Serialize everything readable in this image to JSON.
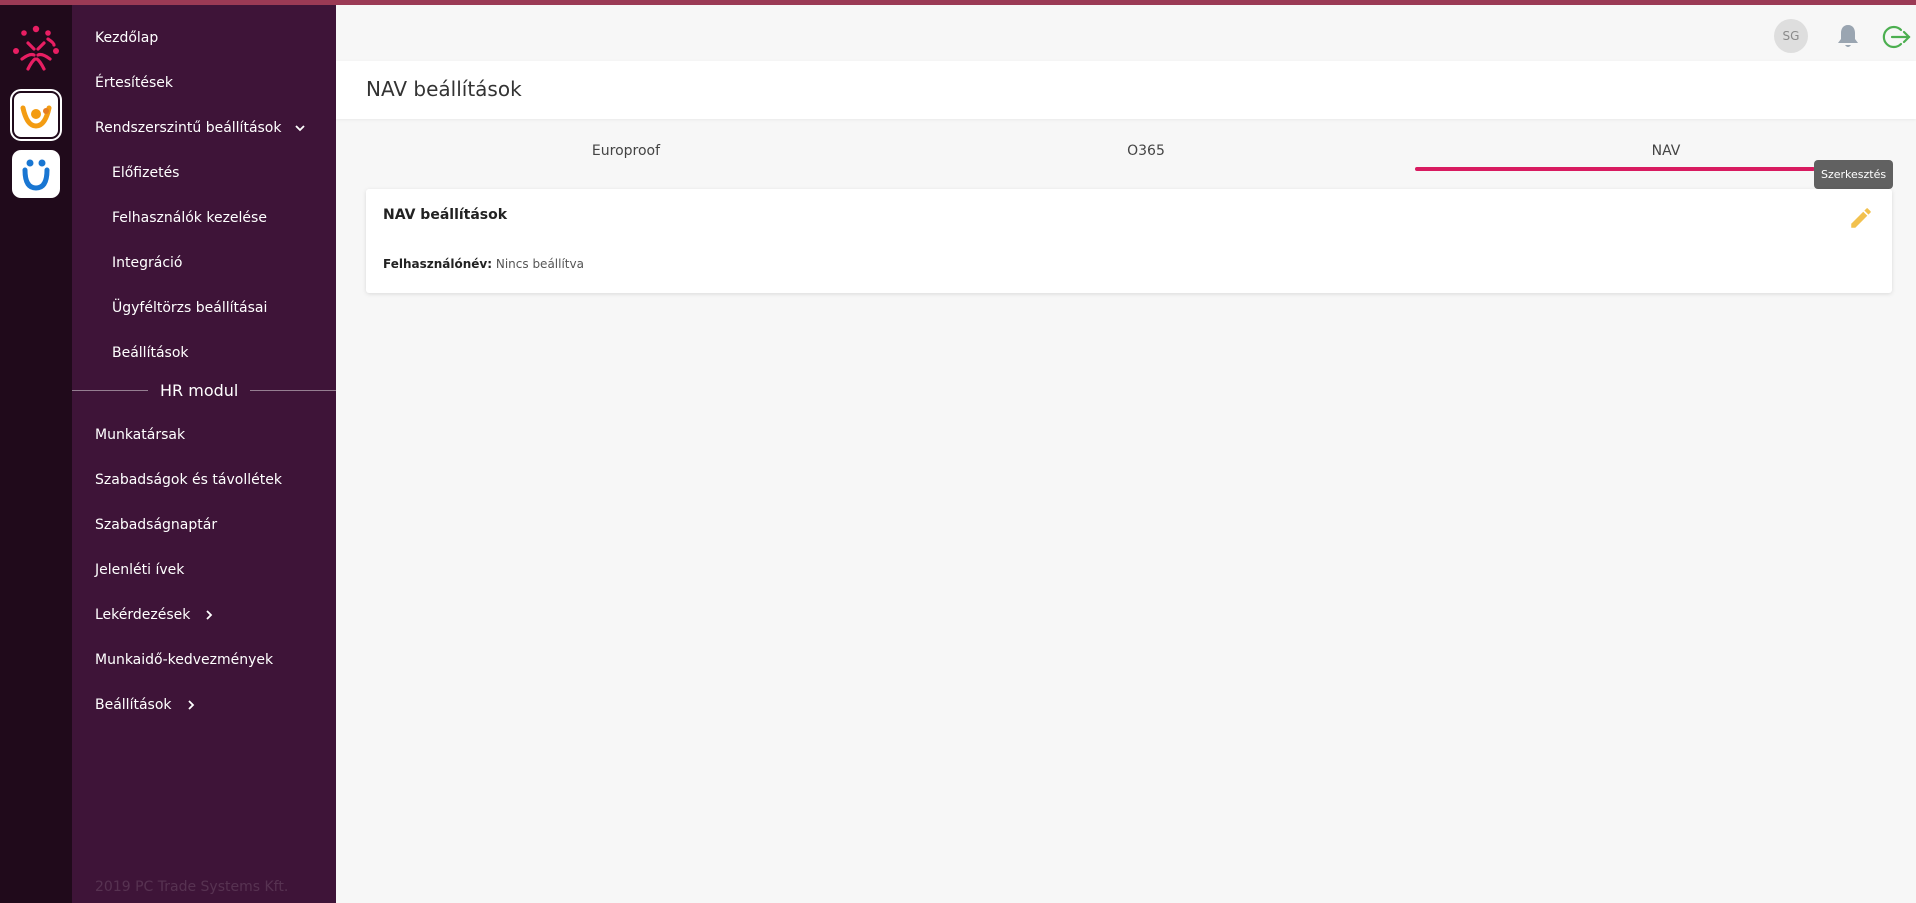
{
  "sidebar": {
    "items": [
      {
        "label": "Kezdőlap"
      },
      {
        "label": "Értesítések"
      },
      {
        "label": "Rendszerszintű beállítások"
      },
      {
        "label": "Előfizetés"
      },
      {
        "label": "Felhasználók kezelése"
      },
      {
        "label": "Integráció"
      },
      {
        "label": "Ügyféltörzs beállításai"
      },
      {
        "label": "Beállítások"
      }
    ],
    "section_title": "HR modul",
    "hr_items": [
      {
        "label": "Munkatársak"
      },
      {
        "label": "Szabadságok és távollétek"
      },
      {
        "label": "Szabadságnaptár"
      },
      {
        "label": "Jelenléti ívek"
      },
      {
        "label": "Lekérdezések"
      },
      {
        "label": "Munkaidő-kedvezmények"
      },
      {
        "label": "Beállítások"
      }
    ],
    "copyright": "2019 PC Trade Systems Kft."
  },
  "header": {
    "avatar_initials": "SG"
  },
  "page": {
    "title": "NAV beállítások"
  },
  "tabs": [
    {
      "label": "Europroof"
    },
    {
      "label": "O365"
    },
    {
      "label": "NAV",
      "active": true
    }
  ],
  "tooltip": "Szerkesztés",
  "card": {
    "title": "NAV beállítások",
    "field_label": "Felhasználónév:",
    "field_value": "Nincs beállítva"
  },
  "colors": {
    "sidebar_bg": "#3e1438",
    "rail_bg": "#200a1b",
    "accent": "#d81b60",
    "edit_icon": "#f2c14e",
    "logout_icon": "#4caf50"
  },
  "icons": {
    "brand_logo": "brand-logo-icon",
    "app_1": "app-orange-icon",
    "app_2": "app-blue-icon",
    "bell": "bell-icon",
    "logout": "logout-icon",
    "edit": "pencil-icon",
    "chevron_down": "chevron-down-icon",
    "chevron_right": "chevron-right-icon"
  }
}
